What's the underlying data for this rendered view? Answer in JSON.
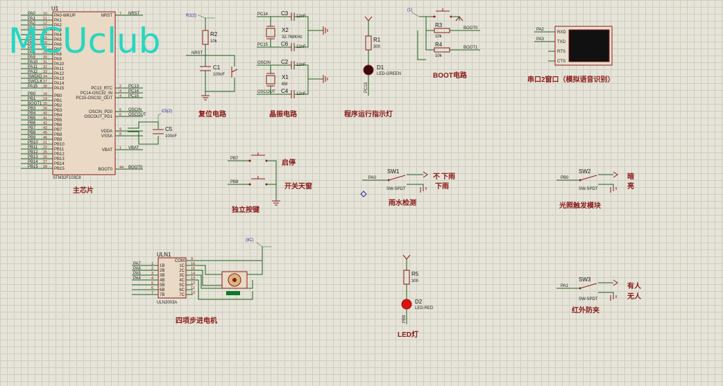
{
  "watermark": "MCUclub",
  "mcu": {
    "ref": "U1",
    "part": "STM32F103C8",
    "caption": "主芯片",
    "left_pins": [
      {
        "label": "PA0",
        "num": "10",
        "inner": "PA0-WKUP"
      },
      {
        "label": "PA1",
        "num": "11",
        "inner": "PA1"
      },
      {
        "label": "PA2",
        "num": "12",
        "inner": "PA2"
      },
      {
        "label": "PA3",
        "num": "13",
        "inner": "PA3"
      },
      {
        "label": "PA4",
        "num": "14",
        "inner": "PA4"
      },
      {
        "label": "PA5",
        "num": "15",
        "inner": "PA5"
      },
      {
        "label": "PA6",
        "num": "16",
        "inner": "PA6"
      },
      {
        "label": "PA7",
        "num": "17",
        "inner": "PA7"
      },
      {
        "label": "PA8",
        "num": "29",
        "inner": "PA8"
      },
      {
        "label": "PA9",
        "num": "30",
        "inner": "PA9"
      },
      {
        "label": "PA10",
        "num": "31",
        "inner": "PA10"
      },
      {
        "label": "PA11",
        "num": "32",
        "inner": "PA11"
      },
      {
        "label": "PA12",
        "num": "33",
        "inner": "PA12"
      },
      {
        "label": "SWDIO",
        "num": "34",
        "inner": "PA13"
      },
      {
        "label": "SWCLK",
        "num": "37",
        "inner": "PA14"
      },
      {
        "label": "PA15",
        "num": "38",
        "inner": "PA15"
      },
      {
        "label": "PB0",
        "num": "18",
        "inner": "PB0"
      },
      {
        "label": "PB1",
        "num": "19",
        "inner": "PB1"
      },
      {
        "label": "BOOT1",
        "num": "20",
        "inner": "PB2"
      },
      {
        "label": "PB3",
        "num": "39",
        "inner": "PB3"
      },
      {
        "label": "PB4",
        "num": "40",
        "inner": "PB4"
      },
      {
        "label": "PB5",
        "num": "41",
        "inner": "PB5"
      },
      {
        "label": "PB6",
        "num": "42",
        "inner": "PB6"
      },
      {
        "label": "PB7",
        "num": "43",
        "inner": "PB7"
      },
      {
        "label": "PB8",
        "num": "45",
        "inner": "PB8"
      },
      {
        "label": "PB9",
        "num": "46",
        "inner": "PB9"
      },
      {
        "label": "PB10",
        "num": "21",
        "inner": "PB10"
      },
      {
        "label": "PB11",
        "num": "22",
        "inner": "PB11"
      },
      {
        "label": "PB12",
        "num": "25",
        "inner": "PB12"
      },
      {
        "label": "PB13",
        "num": "26",
        "inner": "PB13"
      },
      {
        "label": "PB14",
        "num": "27",
        "inner": "PB14"
      },
      {
        "label": "PB15",
        "num": "28",
        "inner": "PB15"
      }
    ],
    "right_pins": [
      {
        "inner": "NRST",
        "num": "7",
        "net": "NRST"
      },
      {
        "inner": "PC13_RTC",
        "num": "2",
        "net": "PC13"
      },
      {
        "inner": "PC14-OSC32_IN",
        "num": "3",
        "net": "PC14"
      },
      {
        "inner": "PC15-OSC32_OUT",
        "num": "4",
        "net": "PC15"
      },
      {
        "inner": "OSCIN_PD0",
        "num": "5",
        "net": "OSCIN"
      },
      {
        "inner": "OSCOUT_PD1",
        "num": "6",
        "net": "OSCOUT"
      },
      {
        "inner": "VDDA",
        "num": "9",
        "net": ""
      },
      {
        "inner": "VSSA",
        "num": "8",
        "net": ""
      },
      {
        "inner": "VBAT",
        "num": "1",
        "net": "VBAT"
      },
      {
        "inner": "BOOT0",
        "num": "44",
        "net": "BOOT0"
      }
    ],
    "c5": {
      "ref": "C5",
      "value": "100nF",
      "probe": "C5(2)"
    }
  },
  "reset": {
    "caption": "复位电路",
    "probe": "R2(2)",
    "r_ref": "R2",
    "r_val": "10k",
    "net": "NRST",
    "c_ref": "C1",
    "c_val": "100nF"
  },
  "crystal": {
    "caption": "晶振电路",
    "x2": {
      "ref": "X2",
      "val": "32.768KHz",
      "n1": "PC14",
      "n2": "PC15"
    },
    "x1": {
      "ref": "X1",
      "val": "8M",
      "n1": "OSCIN",
      "n2": "OSCOUT"
    },
    "caps": [
      {
        "ref": "C3",
        "val": "12nF"
      },
      {
        "ref": "C6",
        "val": "12nF"
      },
      {
        "ref": "C2",
        "val": "12nF"
      },
      {
        "ref": "C4",
        "val": "12nF"
      }
    ]
  },
  "runled": {
    "caption": "程序运行指示灯",
    "r_ref": "R1",
    "r_val": "300",
    "d_ref": "D1",
    "d_part": "LED-GREEN",
    "net": "PC13"
  },
  "boot": {
    "caption": "BOOT电路",
    "probe": "(1)",
    "r3": "R3",
    "r4": "R4",
    "r_val": "10k",
    "n0": "BOOT0",
    "n1": "BOOT1"
  },
  "uart": {
    "caption": "串口2窗口（模拟语音识别）",
    "n1": "PA2",
    "n2": "PA3",
    "pins": [
      "RXD",
      "TXD",
      "RTS",
      "CTS"
    ]
  },
  "keys": {
    "caption": "独立按键",
    "k1_net": "PB7",
    "k1_label": "启停",
    "k2_net": "PB8",
    "k2_label": "开关天窗"
  },
  "rain": {
    "caption": "雨水检测",
    "ref": "SW1",
    "net": "PA0",
    "part": "SW-SPDT",
    "t1": "下雨",
    "t2": "下雨",
    "t1b": "不"
  },
  "light": {
    "caption": "光照触发模块",
    "ref": "SW2",
    "net": "PB0",
    "part": "SW-SPDT",
    "t1": "暗",
    "t2": "亮"
  },
  "ir": {
    "caption": "红外防夹",
    "ref": "SW3",
    "net": "PA1",
    "part": "SW-SPDT",
    "t1": "有人",
    "t2": "无人"
  },
  "stepper": {
    "caption": "四项步进电机",
    "ref": "ULN1",
    "part": "ULN2003A",
    "probe": "(8C)",
    "inputs": [
      {
        "net": "PA7",
        "pin": "1B",
        "num": "1"
      },
      {
        "net": "PA6",
        "pin": "2B",
        "num": "2"
      },
      {
        "net": "PA5",
        "pin": "3B",
        "num": "3"
      },
      {
        "net": "PA4",
        "pin": "4B",
        "num": "4"
      },
      {
        "net": "",
        "pin": "5B",
        "num": "5"
      },
      {
        "net": "",
        "pin": "6B",
        "num": "6"
      },
      {
        "net": "",
        "pin": "7B",
        "num": "7"
      }
    ],
    "outputs": [
      {
        "pin": "COM",
        "num": "9"
      },
      {
        "pin": "1C",
        "num": "16"
      },
      {
        "pin": "2C",
        "num": "15"
      },
      {
        "pin": "3C",
        "num": "14"
      },
      {
        "pin": "4C",
        "num": "13"
      },
      {
        "pin": "5C",
        "num": "12"
      },
      {
        "pin": "6C",
        "num": "11"
      },
      {
        "pin": "7C",
        "num": "10"
      }
    ]
  },
  "led2": {
    "caption": "LED灯",
    "r_ref": "R5",
    "r_val": "300",
    "d_ref": "D2",
    "d_part": "LED-RED",
    "net": "PB9"
  },
  "colors": {
    "wire": "#1f5f1f",
    "component": "#8b1a1a",
    "caption": "#8b1a1a",
    "watermark": "#27d6c1",
    "grid": "#cfcdbf",
    "background": "#e6e4d8",
    "led_green": "#3a0a0a",
    "led_red": "#e01010"
  }
}
